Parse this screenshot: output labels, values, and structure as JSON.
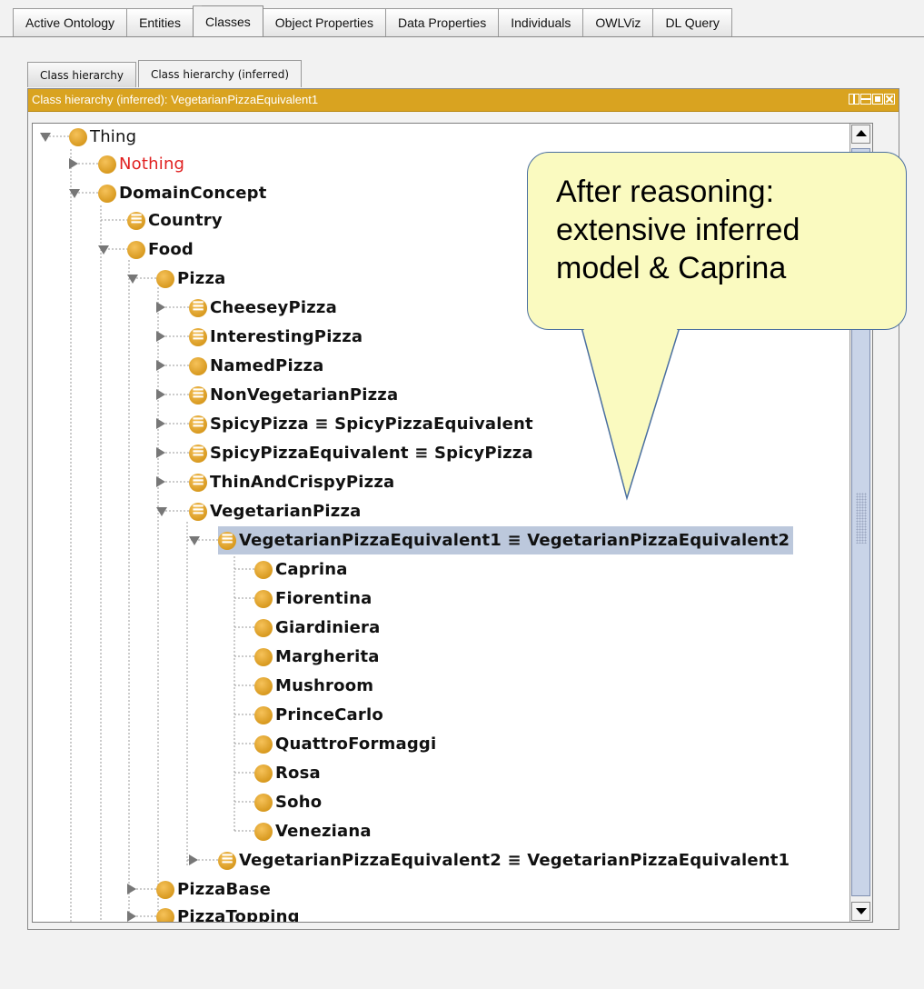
{
  "top_tabs": [
    "Active Ontology",
    "Entities",
    "Classes",
    "Object Properties",
    "Data Properties",
    "Individuals",
    "OWLViz",
    "DL Query"
  ],
  "active_top_tab": "Classes",
  "sub_tabs": [
    "Class hierarchy",
    "Class hierarchy (inferred)"
  ],
  "active_sub_tab": "Class hierarchy (inferred)",
  "panel_title": "Class hierarchy (inferred): VegetarianPizzaEquivalent1",
  "tree": {
    "thing": "Thing",
    "nothing": "Nothing",
    "domain_concept": "DomainConcept",
    "country": "Country",
    "food": "Food",
    "pizza": "Pizza",
    "pizza_children": [
      "CheeseyPizza",
      "InterestingPizza",
      "NamedPizza",
      "NonVegetarianPizza",
      "SpicyPizza ≡ SpicyPizzaEquivalent",
      "SpicyPizzaEquivalent ≡ SpicyPizza",
      "ThinAndCrispyPizza",
      "VegetarianPizza"
    ],
    "selected": "VegetarianPizzaEquivalent1 ≡ VegetarianPizzaEquivalent2",
    "selected_children": [
      "Caprina",
      "Fiorentina",
      "Giardiniera",
      "Margherita",
      "Mushroom",
      "PrinceCarlo",
      "QuattroFormaggi",
      "Rosa",
      "Soho",
      "Veneziana"
    ],
    "equivalent2": "VegetarianPizzaEquivalent2 ≡ VegetarianPizzaEquivalent1",
    "pizza_base": "PizzaBase",
    "pizza_topping": "PizzaTopping"
  },
  "callout": {
    "line1": "After reasoning:",
    "line2": "extensive inferred",
    "line3": "model & Caprina"
  },
  "colors": {
    "class_dot": "#e0a42b",
    "panel_header": "#d9a320",
    "selection": "#bcc8dc",
    "nothing_text": "#e02020",
    "callout_fill": "#fafac0"
  }
}
